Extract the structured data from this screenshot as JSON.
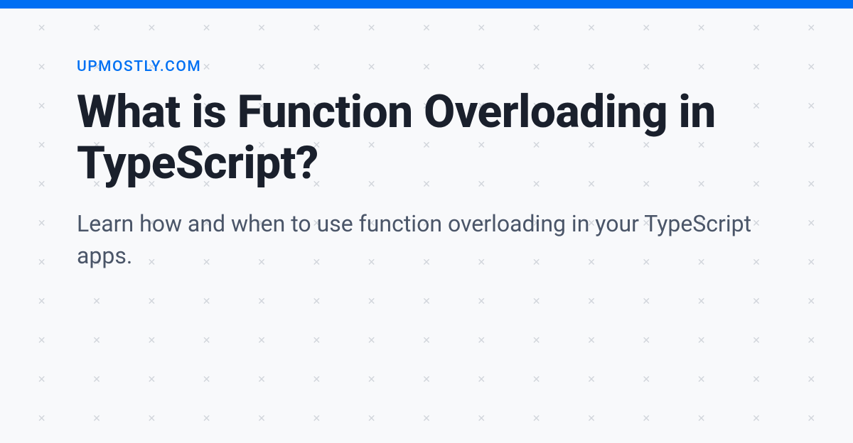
{
  "header": {
    "site_name": "UPMOSTLY.COM"
  },
  "article": {
    "title": "What is Function Overloading in TypeScript?",
    "subtitle": "Learn how and when to use function overloading in your TypeScript apps."
  },
  "colors": {
    "accent": "#0070f3",
    "title_color": "#1a202c",
    "subtitle_color": "#4a5568",
    "background": "#f8f9fb",
    "pattern": "#d1d5db"
  }
}
